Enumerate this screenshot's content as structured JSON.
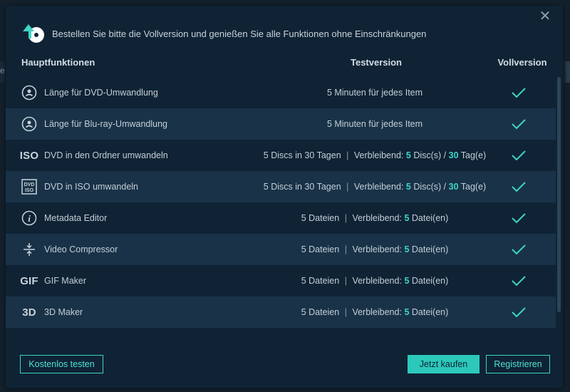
{
  "background": {
    "left_label": "e"
  },
  "dialog": {
    "title": "Bestellen Sie bitte die Vollversion und genießen Sie alle Funktionen ohne Einschränkungen",
    "close_icon": "close-icon",
    "columns": {
      "feature": "Hauptfunktionen",
      "trial": "Testversion",
      "full": "Vollversion"
    },
    "rows": [
      {
        "icon": "disc-person-icon",
        "icon_text": "",
        "name": "Länge für DVD-Umwandlung",
        "trial_plain": "5 Minuten für jedes Item"
      },
      {
        "icon": "disc-person-icon",
        "icon_text": "",
        "name": "Länge für Blu-ray-Umwandlung",
        "trial_plain": "5 Minuten für jedes Item"
      },
      {
        "icon": "iso-text-icon",
        "icon_text": "ISO",
        "name": "DVD in den Ordner umwandeln",
        "trial_a": "5 Discs in 30 Tagen",
        "sep": "|",
        "trial_b": "Verbleibend:",
        "n1": "5",
        "u1": "Disc(s) /",
        "n2": "30",
        "u2": "Tag(e)"
      },
      {
        "icon": "dvd-iso-icon",
        "icon_text": "",
        "name": "DVD in ISO umwandeln",
        "trial_a": "5 Discs in 30 Tagen",
        "sep": "|",
        "trial_b": "Verbleibend:",
        "n1": "5",
        "u1": "Disc(s) /",
        "n2": "30",
        "u2": "Tag(e)"
      },
      {
        "icon": "info-icon",
        "icon_text": "",
        "name": "Metadata Editor",
        "trial_a": "5 Dateien",
        "sep": "|",
        "trial_b": "Verbleibend:",
        "n1": "5",
        "u1": "Datei(en)"
      },
      {
        "icon": "compress-icon",
        "icon_text": "",
        "name": "Video Compressor",
        "trial_a": "5 Dateien",
        "sep": "|",
        "trial_b": "Verbleibend:",
        "n1": "5",
        "u1": "Datei(en)"
      },
      {
        "icon": "gif-text-icon",
        "icon_text": "GIF",
        "name": "GIF Maker",
        "trial_a": "5 Dateien",
        "sep": "|",
        "trial_b": "Verbleibend:",
        "n1": "5",
        "u1": "Datei(en)"
      },
      {
        "icon": "3d-text-icon",
        "icon_text": "3D",
        "name": "3D Maker",
        "trial_a": "5 Dateien",
        "sep": "|",
        "trial_b": "Verbleibend:",
        "n1": "5",
        "u1": "Datei(en)"
      }
    ],
    "buttons": {
      "free_trial": "Kostenlos testen",
      "buy": "Jetzt kaufen",
      "register": "Registrieren"
    }
  },
  "colors": {
    "accent": "#3fd4c6",
    "dialog_bg": "#0f2334",
    "row_alt": "#193247"
  }
}
